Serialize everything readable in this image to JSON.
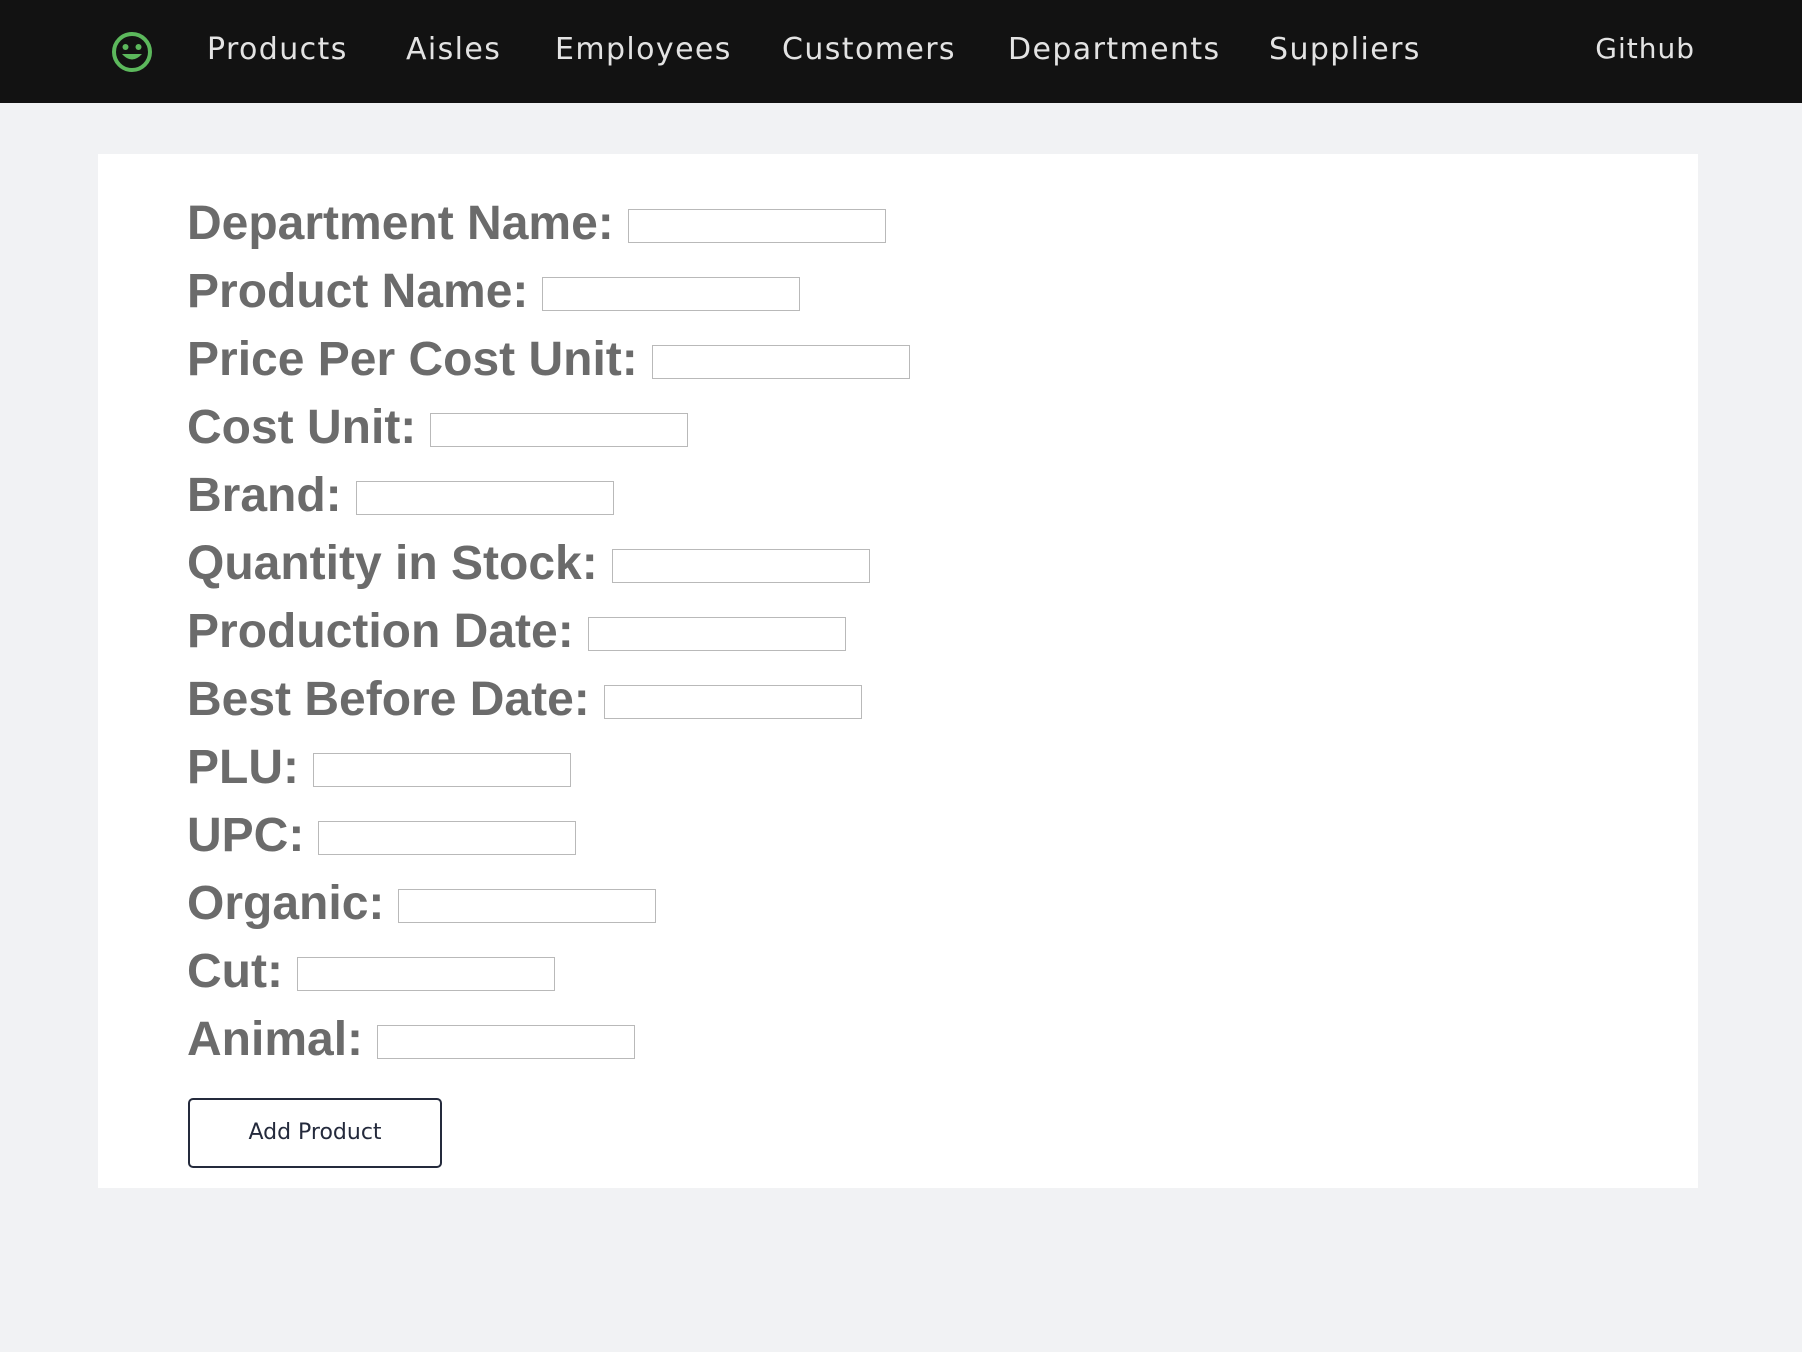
{
  "navbar": {
    "logo_icon": "smiley-face-icon",
    "logo_color": "#5cb85c",
    "links": [
      "Products",
      "Aisles",
      "Employees",
      "Customers",
      "Departments",
      "Suppliers"
    ],
    "github_label": "Github"
  },
  "form": {
    "fields": [
      {
        "label": "Department Name:",
        "value": ""
      },
      {
        "label": "Product Name:",
        "value": ""
      },
      {
        "label": "Price Per Cost Unit:",
        "value": ""
      },
      {
        "label": "Cost Unit:",
        "value": ""
      },
      {
        "label": "Brand:",
        "value": ""
      },
      {
        "label": "Quantity in Stock:",
        "value": ""
      },
      {
        "label": "Production Date:",
        "value": ""
      },
      {
        "label": "Best Before Date:",
        "value": ""
      },
      {
        "label": "PLU:",
        "value": ""
      },
      {
        "label": "UPC:",
        "value": ""
      },
      {
        "label": "Organic:",
        "value": ""
      },
      {
        "label": "Cut:",
        "value": ""
      },
      {
        "label": "Animal:",
        "value": ""
      }
    ],
    "submit_label": "Add Product"
  }
}
